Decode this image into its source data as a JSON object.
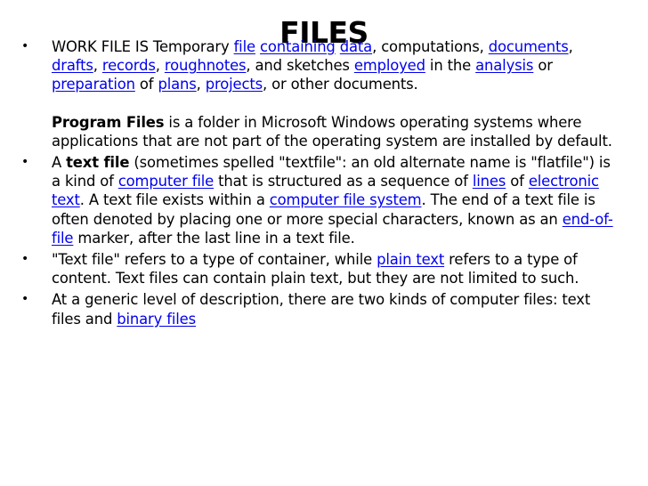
{
  "slide": {
    "title": "FILES",
    "bullet_char": "•",
    "item1": {
      "t0": "WORK FILE IS Temporary ",
      "l1": "file",
      "t1": " ",
      "l2": "containing",
      "t2": " ",
      "l3": "data",
      "t3": ", computations, ",
      "l4": "documents",
      "t4": ", ",
      "l5": "drafts",
      "t5": ", ",
      "l6": "records",
      "t6": ", ",
      "l7": "roughnotes",
      "t7": ", and sketches ",
      "l8": "employed",
      "t8": " in the ",
      "l9": "analysis",
      "t9": " or ",
      "l10": "preparation",
      "t10": " of ",
      "l11": "plans",
      "t11": ", ",
      "l12": "projects",
      "t12": ", or other documents.",
      "pf_bold": "Program Files",
      "pf_rest": " is a folder in Microsoft Windows operating systems where applications that are not part of the operating system are installed by default."
    },
    "item2": {
      "t0": "A ",
      "bold": "text file",
      "t1": " (sometimes spelled \"textfile\": an old alternate name is \"flatfile\") is a kind of ",
      "l1": "computer file",
      "t2": " that is structured as a sequence of ",
      "l2": "lines",
      "t3": " of ",
      "l3": "electronic text",
      "t4": ". A text file exists within a ",
      "l4": "computer file system",
      "t5": ". The end of a text file is often denoted by placing one or more special characters, known as an ",
      "l5": "end-of-file",
      "t6": " marker, after the last line in a text file."
    },
    "item3": {
      "t0": "\"Text file\" refers to a type of container, while ",
      "l1": "plain text",
      "t1": " refers to a type of content. Text files can contain plain text, but they are not limited to such."
    },
    "item4": {
      "t0": "At a generic level of description, there are two kinds of computer files: text files and ",
      "l1": "binary files"
    }
  }
}
